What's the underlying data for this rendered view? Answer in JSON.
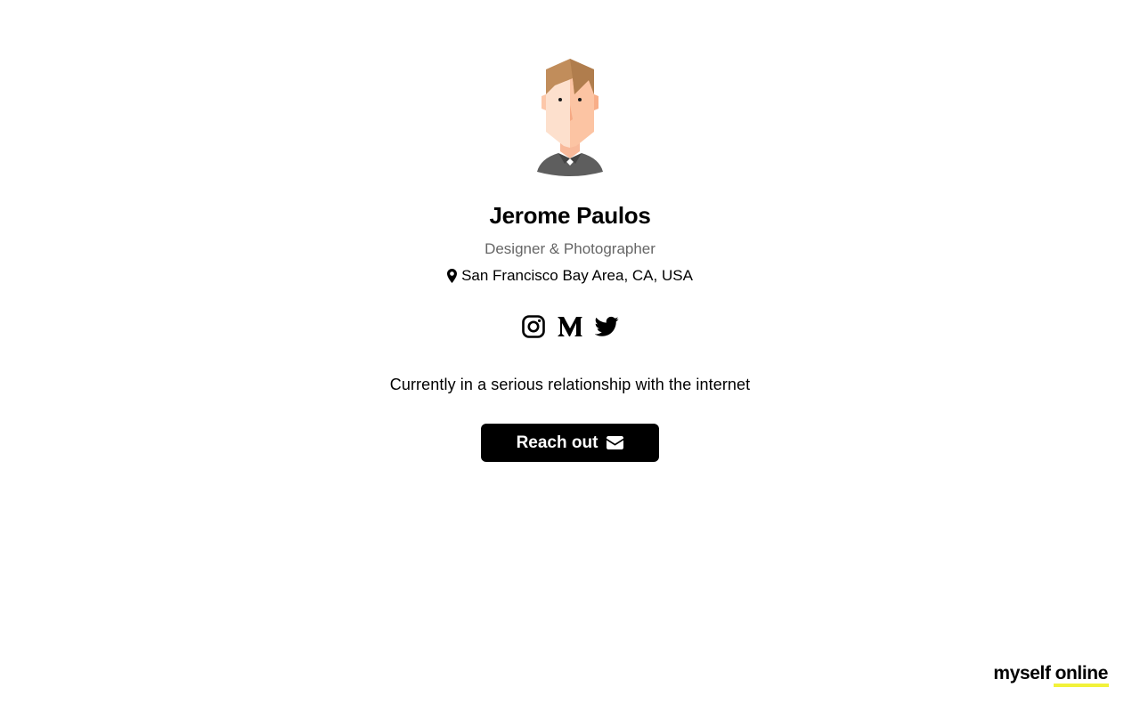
{
  "profile": {
    "name": "Jerome Paulos",
    "subtitle": "Designer & Photographer",
    "location": "San Francisco Bay Area, CA, USA",
    "bio": "Currently in a serious relationship with the internet"
  },
  "socials": [
    {
      "icon": "instagram-icon"
    },
    {
      "icon": "medium-icon"
    },
    {
      "icon": "twitter-icon"
    }
  ],
  "cta": {
    "label": "Reach out",
    "icon": "envelope-icon"
  },
  "brand": {
    "part1": "myself",
    "part2": "online",
    "underline_color": "#f2f23a"
  },
  "colors": {
    "text": "#000000",
    "muted": "#666666",
    "button_bg": "#000000",
    "button_text": "#ffffff"
  }
}
